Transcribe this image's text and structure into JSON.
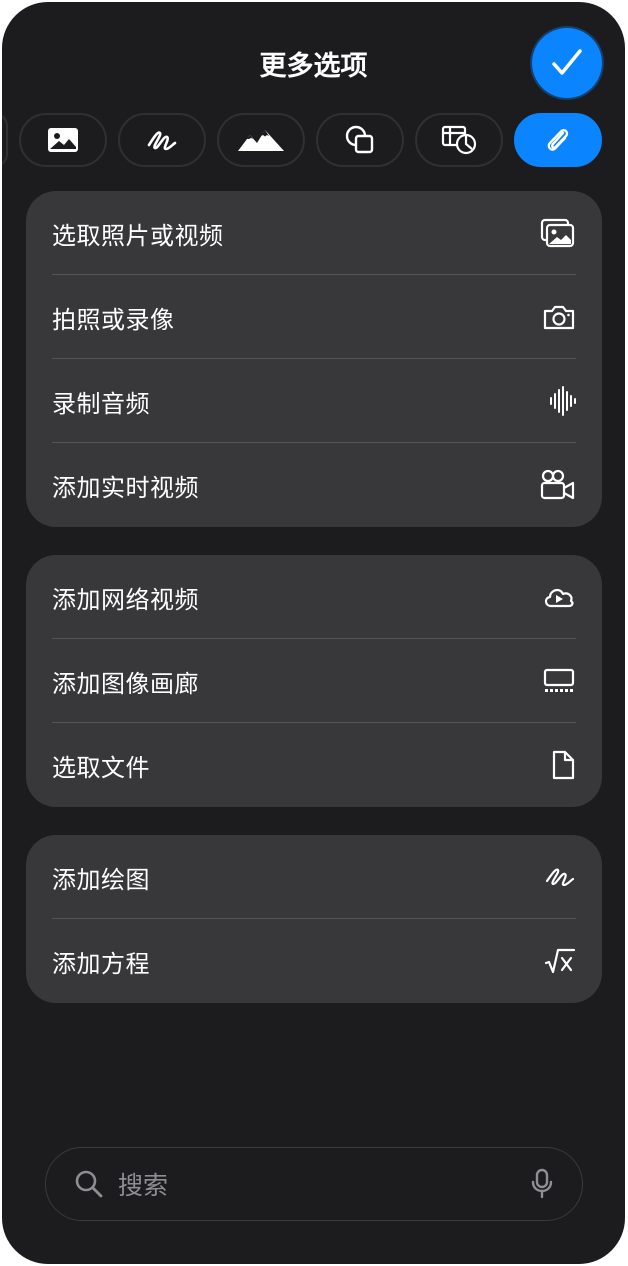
{
  "header": {
    "title": "更多选项"
  },
  "categories": [
    "image",
    "drawing",
    "landscape",
    "shapes",
    "table-chart",
    "attachment"
  ],
  "groups": [
    {
      "items": [
        {
          "label": "选取照片或视频",
          "icon": "photo-library-icon"
        },
        {
          "label": "拍照或录像",
          "icon": "camera-icon"
        },
        {
          "label": "录制音频",
          "icon": "waveform-icon"
        },
        {
          "label": "添加实时视频",
          "icon": "video-camera-icon"
        }
      ]
    },
    {
      "items": [
        {
          "label": "添加网络视频",
          "icon": "cloud-play-icon"
        },
        {
          "label": "添加图像画廊",
          "icon": "gallery-icon"
        },
        {
          "label": "选取文件",
          "icon": "document-icon"
        }
      ]
    },
    {
      "items": [
        {
          "label": "添加绘图",
          "icon": "scribble-icon"
        },
        {
          "label": "添加方程",
          "icon": "square-root-icon"
        }
      ]
    }
  ],
  "search": {
    "placeholder": "搜索"
  },
  "colors": {
    "accent": "#0a84ff",
    "sheet": "#1c1c1e",
    "group": "#38383a"
  }
}
